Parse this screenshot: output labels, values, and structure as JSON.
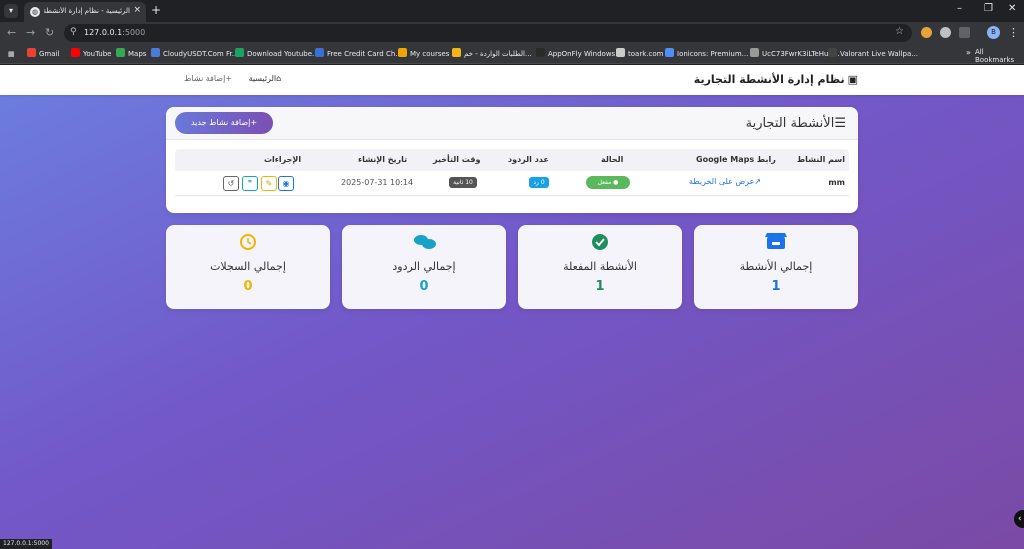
{
  "browser": {
    "tab_title": "الرئيسية - نظام إدارة الأنشطة الت...",
    "url_host": "127.0.0.1",
    "url_port": ":5000",
    "status_url": "127.0.0.1:5000",
    "profile_initial": "B",
    "bookmarks": [
      {
        "label": "Gmail",
        "color": "#ea4335"
      },
      {
        "label": "YouTube",
        "color": "#ff0000"
      },
      {
        "label": "Maps",
        "color": "#34a853"
      },
      {
        "label": "CloudyUSDT.Com Fr...",
        "color": "#4f79d8"
      },
      {
        "label": "Download Youtube...",
        "color": "#1aa260"
      },
      {
        "label": "Free Credit Card Ch...",
        "color": "#3a6fd8"
      },
      {
        "label": "My courses",
        "color": "#f0a500"
      },
      {
        "label": "الطلبات الواردة - خم...",
        "color": "#f6b31a"
      },
      {
        "label": "AppOnFly Windows...",
        "color": "#2a2a2a"
      },
      {
        "label": "toark.com",
        "color": "#cccccc"
      },
      {
        "label": "Ionicons: Premium...",
        "color": "#4e8ef7"
      },
      {
        "label": "UcC73FwrK3iLTeHuS...",
        "color": "#999999"
      },
      {
        "label": "Valorant Live Wallpa...",
        "color": "#444444"
      }
    ],
    "bookmarks_more": "»",
    "all_bookmarks": "All Bookmarks"
  },
  "navbar": {
    "brand": "نظام إدارة الأنشطة التجارية",
    "home_link": "الرئيسية",
    "add_link": "إضافة نشاط"
  },
  "activities_card": {
    "title": "الأنشطة التجارية",
    "add_button": "إضافة نشاط جديد",
    "columns": {
      "name": "اسم النشاط",
      "maps": "رابط Google Maps",
      "status": "الحالة",
      "replies": "عدد الردود",
      "delay": "وقت التأخير",
      "created": "تاريخ الإنشاء",
      "actions": "الإجراءات"
    },
    "rows": [
      {
        "name": "mm",
        "map_link": "عرض على الخريطة",
        "status": "مفعل",
        "replies": "0 رد",
        "delay": "10 ثانية",
        "created": "2025-07-31 10:14"
      }
    ]
  },
  "stats": [
    {
      "label": "إجمالي الأنشطة",
      "value": "1",
      "icon": "store-icon",
      "color": "#1a73e8"
    },
    {
      "label": "الأنشطة المفعلة",
      "value": "1",
      "icon": "check-circle-icon",
      "color": "#1e8e5e"
    },
    {
      "label": "إجمالي الردود",
      "value": "0",
      "icon": "comments-icon",
      "color": "#17a2c8"
    },
    {
      "label": "إجمالي السجلات",
      "value": "0",
      "icon": "history-icon",
      "color": "#f4b400"
    }
  ],
  "colors": {
    "gradient_start": "#6c7fe0",
    "gradient_end": "#7a4aa5",
    "accent": "#7b4fb3"
  }
}
